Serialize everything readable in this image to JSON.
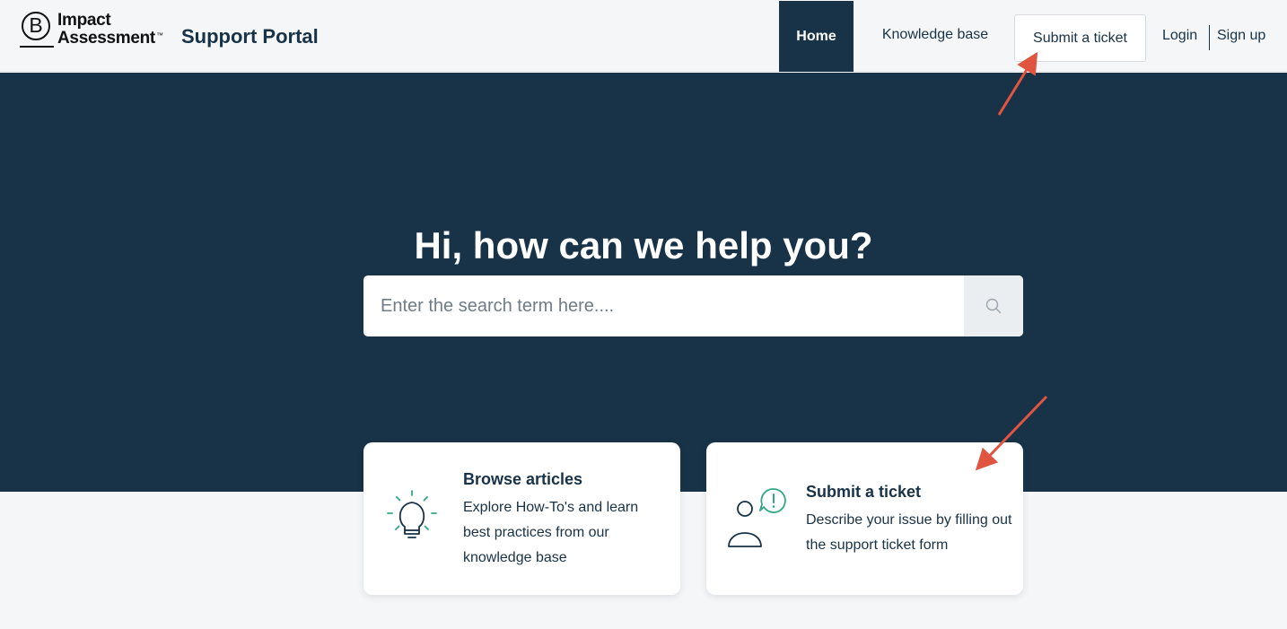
{
  "header": {
    "logo_text_line1": "Impact",
    "logo_text_line2": "Assessment",
    "logo_letter": "B",
    "portal_title": "Support Portal",
    "nav": {
      "home": "Home",
      "knowledge_base": "Knowledge base",
      "submit_ticket": "Submit a ticket",
      "login": "Login",
      "signup": "Sign up"
    }
  },
  "hero": {
    "title": "Hi, how can we help you?",
    "search_placeholder": "Enter the search term here...."
  },
  "cards": [
    {
      "title": "Browse articles",
      "description": "Explore How-To's and learn best practices from our knowledge base",
      "icon": "lightbulb-icon"
    },
    {
      "title": "Submit a ticket",
      "description": "Describe your issue by filling out the support ticket form",
      "icon": "user-alert-icon"
    }
  ],
  "colors": {
    "navy": "#183247",
    "page_bg": "#f5f6f8",
    "accent_green": "#2fa783",
    "annotation_arrow": "#e0553f"
  }
}
